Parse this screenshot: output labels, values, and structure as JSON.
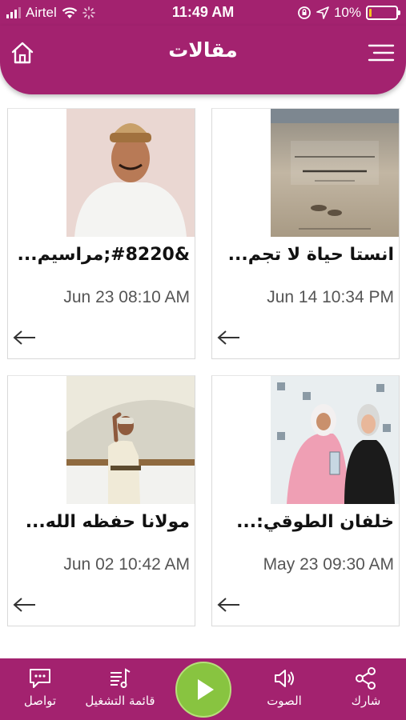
{
  "status_bar": {
    "carrier": "Airtel",
    "time": "11:49 AM",
    "battery_percent": "10%",
    "battery_level": 0.1
  },
  "header": {
    "title": "مقالات",
    "home_icon": "home-icon",
    "menu_icon": "hamburger-menu-icon"
  },
  "articles": [
    {
      "title": "انستا حياة لا تجم...",
      "date": "Jun 14 10:34 PM",
      "image": "sand-footprints-book-cover"
    },
    {
      "title": "&#8220;مراسيم...",
      "date": "Jun 23 08:10 AM",
      "image": "man-in-omani-cap-portrait"
    },
    {
      "title": "خلفان الطوقي:...",
      "date": "May 23 09:30 AM",
      "image": "two-women-with-award"
    },
    {
      "title": "مولانا حفظه الله...",
      "date": "Jun 02 10:42 AM",
      "image": "sultan-waving-on-ship"
    }
  ],
  "bottom_bar": {
    "share": "شارك",
    "sound": "الصوت",
    "playlist": "قائمة التشغيل",
    "contact": "تواصل",
    "play_icon": "play-icon"
  },
  "colors": {
    "primary": "#a3226f",
    "play": "#88c440"
  }
}
